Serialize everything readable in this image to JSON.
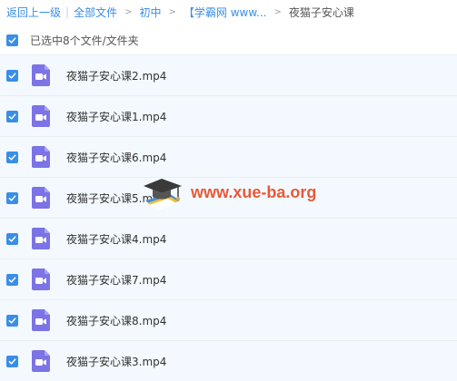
{
  "breadcrumb": {
    "back": "返回上一级",
    "all_files": "全部文件",
    "level1": "初中",
    "level2": "【学霸网 www...",
    "current": "夜猫子安心课"
  },
  "selection": {
    "summary": "已选中8个文件/文件夹"
  },
  "icons": {
    "checkbox": "checkmark-icon",
    "file": "video-file-icon"
  },
  "colors": {
    "accent": "#3a8ee6",
    "file_icon": "#7b73e6",
    "row_bg": "#f3f9fe",
    "watermark": "#e8583a"
  },
  "files": [
    {
      "name": "夜猫子安心课2.mp4",
      "checked": true
    },
    {
      "name": "夜猫子安心课1.mp4",
      "checked": true
    },
    {
      "name": "夜猫子安心课6.mp4",
      "checked": true
    },
    {
      "name": "夜猫子安心课5.mp4",
      "checked": true
    },
    {
      "name": "夜猫子安心课4.mp4",
      "checked": true
    },
    {
      "name": "夜猫子安心课7.mp4",
      "checked": true
    },
    {
      "name": "夜猫子安心课8.mp4",
      "checked": true
    },
    {
      "name": "夜猫子安心课3.mp4",
      "checked": true
    }
  ],
  "watermark": {
    "text": "www.xue-ba.org"
  }
}
